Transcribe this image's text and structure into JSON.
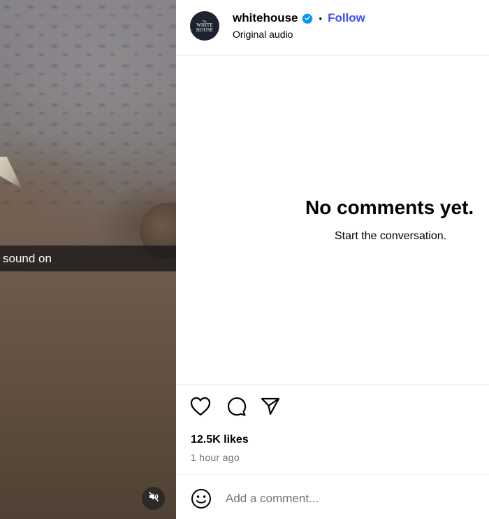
{
  "video": {
    "sound_banner": "sound on",
    "mute_icon": "speaker-muted-icon"
  },
  "header": {
    "avatar_text_small": "The",
    "avatar_text_line1": "WHITE",
    "avatar_text_line2": "HOUSE",
    "username": "whitehouse",
    "verified_icon": "verified-badge-icon",
    "separator": "•",
    "follow_label": "Follow",
    "audio_label": "Original audio"
  },
  "comments": {
    "empty_title": "No comments yet.",
    "empty_subtitle": "Start the conversation."
  },
  "actions": {
    "icons": [
      "heart-icon",
      "comment-icon",
      "share-icon"
    ],
    "likes": "12.5K likes",
    "time": "1 hour ago"
  },
  "add_comment": {
    "emoji_icon": "emoji-icon",
    "placeholder": "Add a comment..."
  },
  "colors": {
    "follow": "#4150f7",
    "verified": "#0095f6",
    "muted_text": "#737373",
    "divider": "#efefef"
  }
}
